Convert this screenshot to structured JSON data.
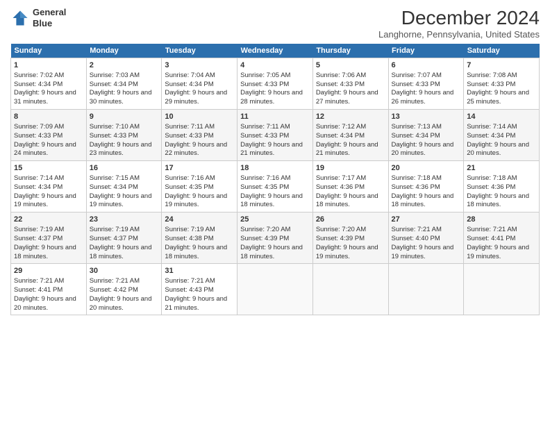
{
  "header": {
    "title": "December 2024",
    "subtitle": "Langhorne, Pennsylvania, United States",
    "logo_line1": "General",
    "logo_line2": "Blue"
  },
  "days_of_week": [
    "Sunday",
    "Monday",
    "Tuesday",
    "Wednesday",
    "Thursday",
    "Friday",
    "Saturday"
  ],
  "weeks": [
    [
      {
        "day": 1,
        "sunrise": "7:02 AM",
        "sunset": "4:34 PM",
        "daylight": "9 hours and 31 minutes."
      },
      {
        "day": 2,
        "sunrise": "7:03 AM",
        "sunset": "4:34 PM",
        "daylight": "9 hours and 30 minutes."
      },
      {
        "day": 3,
        "sunrise": "7:04 AM",
        "sunset": "4:34 PM",
        "daylight": "9 hours and 29 minutes."
      },
      {
        "day": 4,
        "sunrise": "7:05 AM",
        "sunset": "4:33 PM",
        "daylight": "9 hours and 28 minutes."
      },
      {
        "day": 5,
        "sunrise": "7:06 AM",
        "sunset": "4:33 PM",
        "daylight": "9 hours and 27 minutes."
      },
      {
        "day": 6,
        "sunrise": "7:07 AM",
        "sunset": "4:33 PM",
        "daylight": "9 hours and 26 minutes."
      },
      {
        "day": 7,
        "sunrise": "7:08 AM",
        "sunset": "4:33 PM",
        "daylight": "9 hours and 25 minutes."
      }
    ],
    [
      {
        "day": 8,
        "sunrise": "7:09 AM",
        "sunset": "4:33 PM",
        "daylight": "9 hours and 24 minutes."
      },
      {
        "day": 9,
        "sunrise": "7:10 AM",
        "sunset": "4:33 PM",
        "daylight": "9 hours and 23 minutes."
      },
      {
        "day": 10,
        "sunrise": "7:11 AM",
        "sunset": "4:33 PM",
        "daylight": "9 hours and 22 minutes."
      },
      {
        "day": 11,
        "sunrise": "7:11 AM",
        "sunset": "4:33 PM",
        "daylight": "9 hours and 21 minutes."
      },
      {
        "day": 12,
        "sunrise": "7:12 AM",
        "sunset": "4:34 PM",
        "daylight": "9 hours and 21 minutes."
      },
      {
        "day": 13,
        "sunrise": "7:13 AM",
        "sunset": "4:34 PM",
        "daylight": "9 hours and 20 minutes."
      },
      {
        "day": 14,
        "sunrise": "7:14 AM",
        "sunset": "4:34 PM",
        "daylight": "9 hours and 20 minutes."
      }
    ],
    [
      {
        "day": 15,
        "sunrise": "7:14 AM",
        "sunset": "4:34 PM",
        "daylight": "9 hours and 19 minutes."
      },
      {
        "day": 16,
        "sunrise": "7:15 AM",
        "sunset": "4:34 PM",
        "daylight": "9 hours and 19 minutes."
      },
      {
        "day": 17,
        "sunrise": "7:16 AM",
        "sunset": "4:35 PM",
        "daylight": "9 hours and 19 minutes."
      },
      {
        "day": 18,
        "sunrise": "7:16 AM",
        "sunset": "4:35 PM",
        "daylight": "9 hours and 18 minutes."
      },
      {
        "day": 19,
        "sunrise": "7:17 AM",
        "sunset": "4:36 PM",
        "daylight": "9 hours and 18 minutes."
      },
      {
        "day": 20,
        "sunrise": "7:18 AM",
        "sunset": "4:36 PM",
        "daylight": "9 hours and 18 minutes."
      },
      {
        "day": 21,
        "sunrise": "7:18 AM",
        "sunset": "4:36 PM",
        "daylight": "9 hours and 18 minutes."
      }
    ],
    [
      {
        "day": 22,
        "sunrise": "7:19 AM",
        "sunset": "4:37 PM",
        "daylight": "9 hours and 18 minutes."
      },
      {
        "day": 23,
        "sunrise": "7:19 AM",
        "sunset": "4:37 PM",
        "daylight": "9 hours and 18 minutes."
      },
      {
        "day": 24,
        "sunrise": "7:19 AM",
        "sunset": "4:38 PM",
        "daylight": "9 hours and 18 minutes."
      },
      {
        "day": 25,
        "sunrise": "7:20 AM",
        "sunset": "4:39 PM",
        "daylight": "9 hours and 18 minutes."
      },
      {
        "day": 26,
        "sunrise": "7:20 AM",
        "sunset": "4:39 PM",
        "daylight": "9 hours and 19 minutes."
      },
      {
        "day": 27,
        "sunrise": "7:21 AM",
        "sunset": "4:40 PM",
        "daylight": "9 hours and 19 minutes."
      },
      {
        "day": 28,
        "sunrise": "7:21 AM",
        "sunset": "4:41 PM",
        "daylight": "9 hours and 19 minutes."
      }
    ],
    [
      {
        "day": 29,
        "sunrise": "7:21 AM",
        "sunset": "4:41 PM",
        "daylight": "9 hours and 20 minutes."
      },
      {
        "day": 30,
        "sunrise": "7:21 AM",
        "sunset": "4:42 PM",
        "daylight": "9 hours and 20 minutes."
      },
      {
        "day": 31,
        "sunrise": "7:21 AM",
        "sunset": "4:43 PM",
        "daylight": "9 hours and 21 minutes."
      },
      null,
      null,
      null,
      null
    ]
  ]
}
